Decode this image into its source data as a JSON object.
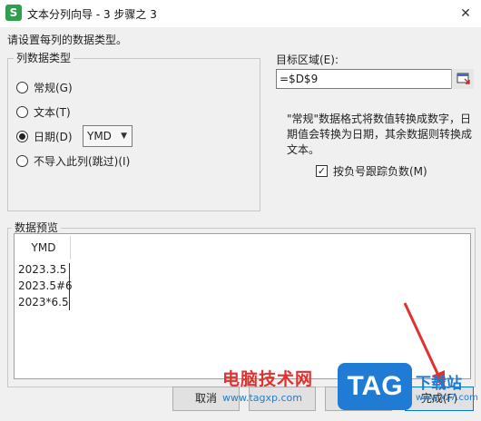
{
  "window": {
    "app_icon_letter": "S",
    "title": "文本分列向导 - 3 步骤之 3",
    "close_glyph": "✕"
  },
  "prompt": "请设置每列的数据类型。",
  "column_type": {
    "legend": "列数据类型",
    "options": [
      {
        "label": "常规(G)",
        "selected": false
      },
      {
        "label": "文本(T)",
        "selected": false
      },
      {
        "label": "日期(D)",
        "selected": true
      },
      {
        "label": "不导入此列(跳过)(I)",
        "selected": false
      }
    ],
    "date_format": "YMD"
  },
  "destination": {
    "label": "目标区域(E):",
    "value": "=$D$9"
  },
  "description": "\"常规\"数据格式将数值转换成数字，日期值会转换为日期，其余数据则转换成文本。",
  "negative_checkbox": {
    "label": "按负号跟踪负数(M)",
    "checked": true,
    "check_glyph": "✓"
  },
  "preview": {
    "legend": "数据预览",
    "header": "YMD",
    "rows": [
      "2023.3.5",
      "2023.5#6",
      "2023*6.5"
    ]
  },
  "buttons": {
    "cancel": "取消",
    "finish": "完成(F)"
  },
  "watermark": {
    "site_name": "电脑技术网",
    "site_url": "www.tagxp.com",
    "logo_text": "TAG",
    "download_text": "下载站",
    "download_url": "www.xz7.com"
  },
  "colors": {
    "accent_red": "#e0312f",
    "logo_blue": "#1f7bd4",
    "app_green": "#2f9e4f"
  }
}
